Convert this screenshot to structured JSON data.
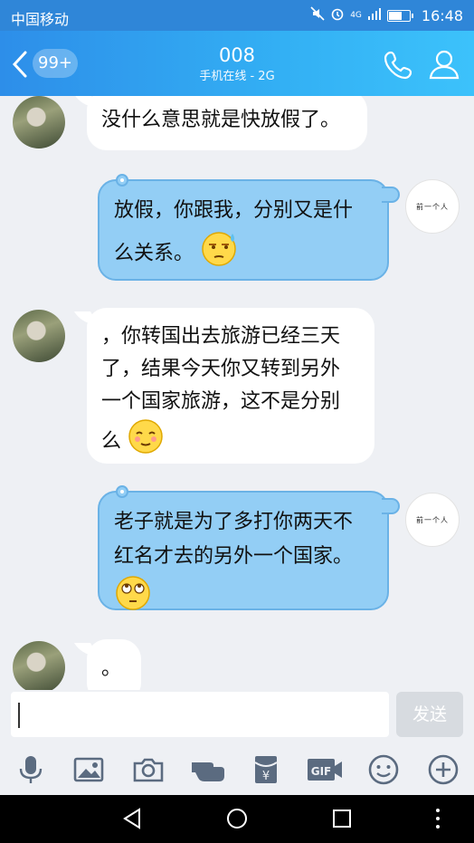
{
  "status_bar": {
    "carrier": "中国移动",
    "network": "4G",
    "time": "16:48",
    "battery_level": 0.6
  },
  "header": {
    "unread_badge": "99+",
    "title": "008",
    "subtitle": "手机在线 - 2G"
  },
  "messages": [
    {
      "side": "in",
      "text": "没什么意思就是快放假了。"
    },
    {
      "side": "out",
      "line1": "放假，你跟我，分别又是什",
      "line2": "么关系。",
      "emoji": "sweat-face-icon"
    },
    {
      "side": "in",
      "line1": "，你转国出去旅游已经三天",
      "line2": "了，结果今天你又转到另外",
      "line3": "一个国家旅游，这不是分别",
      "line4": "么",
      "emoji": "blush-face-icon"
    },
    {
      "side": "out",
      "line1": "老子就是为了多打你两天不",
      "line2": "红名才去的另外一个国家。",
      "emoji": "rolling-eyes-face-icon"
    },
    {
      "side": "in",
      "text": "。"
    }
  ],
  "my_avatar_text": "前一个人",
  "input": {
    "value": "",
    "send_label": "发送"
  },
  "toolbar_icons": [
    "microphone-icon",
    "image-icon",
    "camera-icon",
    "poke-hand-icon",
    "red-packet-icon",
    "gif-icon",
    "emoji-icon",
    "plus-icon"
  ],
  "colors": {
    "header_start": "#2d8ee9",
    "header_end": "#3cc2fb",
    "outgoing_bubble": "#93cef5",
    "incoming_bubble": "#ffffff"
  }
}
